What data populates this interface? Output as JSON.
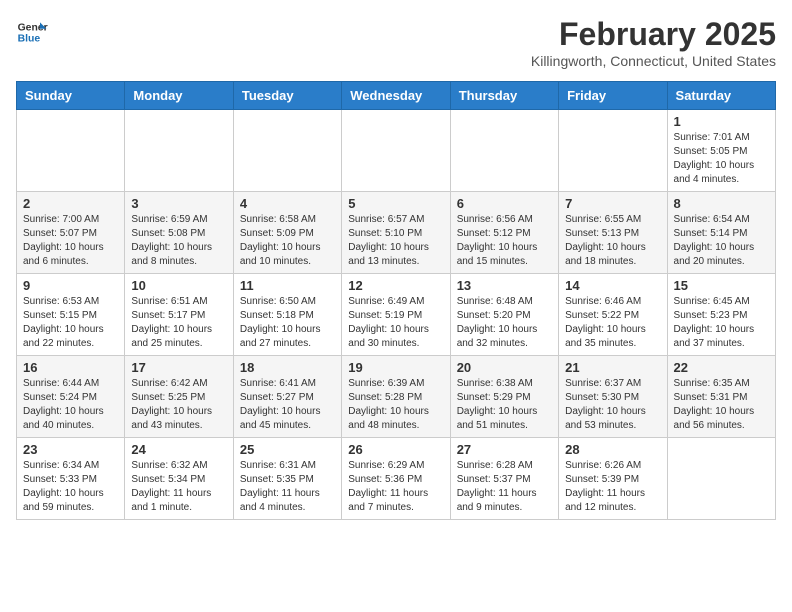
{
  "header": {
    "logo_general": "General",
    "logo_blue": "Blue",
    "month_title": "February 2025",
    "location": "Killingworth, Connecticut, United States"
  },
  "weekdays": [
    "Sunday",
    "Monday",
    "Tuesday",
    "Wednesday",
    "Thursday",
    "Friday",
    "Saturday"
  ],
  "weeks": [
    [
      {
        "day": "",
        "info": ""
      },
      {
        "day": "",
        "info": ""
      },
      {
        "day": "",
        "info": ""
      },
      {
        "day": "",
        "info": ""
      },
      {
        "day": "",
        "info": ""
      },
      {
        "day": "",
        "info": ""
      },
      {
        "day": "1",
        "info": "Sunrise: 7:01 AM\nSunset: 5:05 PM\nDaylight: 10 hours and 4 minutes."
      }
    ],
    [
      {
        "day": "2",
        "info": "Sunrise: 7:00 AM\nSunset: 5:07 PM\nDaylight: 10 hours and 6 minutes."
      },
      {
        "day": "3",
        "info": "Sunrise: 6:59 AM\nSunset: 5:08 PM\nDaylight: 10 hours and 8 minutes."
      },
      {
        "day": "4",
        "info": "Sunrise: 6:58 AM\nSunset: 5:09 PM\nDaylight: 10 hours and 10 minutes."
      },
      {
        "day": "5",
        "info": "Sunrise: 6:57 AM\nSunset: 5:10 PM\nDaylight: 10 hours and 13 minutes."
      },
      {
        "day": "6",
        "info": "Sunrise: 6:56 AM\nSunset: 5:12 PM\nDaylight: 10 hours and 15 minutes."
      },
      {
        "day": "7",
        "info": "Sunrise: 6:55 AM\nSunset: 5:13 PM\nDaylight: 10 hours and 18 minutes."
      },
      {
        "day": "8",
        "info": "Sunrise: 6:54 AM\nSunset: 5:14 PM\nDaylight: 10 hours and 20 minutes."
      }
    ],
    [
      {
        "day": "9",
        "info": "Sunrise: 6:53 AM\nSunset: 5:15 PM\nDaylight: 10 hours and 22 minutes."
      },
      {
        "day": "10",
        "info": "Sunrise: 6:51 AM\nSunset: 5:17 PM\nDaylight: 10 hours and 25 minutes."
      },
      {
        "day": "11",
        "info": "Sunrise: 6:50 AM\nSunset: 5:18 PM\nDaylight: 10 hours and 27 minutes."
      },
      {
        "day": "12",
        "info": "Sunrise: 6:49 AM\nSunset: 5:19 PM\nDaylight: 10 hours and 30 minutes."
      },
      {
        "day": "13",
        "info": "Sunrise: 6:48 AM\nSunset: 5:20 PM\nDaylight: 10 hours and 32 minutes."
      },
      {
        "day": "14",
        "info": "Sunrise: 6:46 AM\nSunset: 5:22 PM\nDaylight: 10 hours and 35 minutes."
      },
      {
        "day": "15",
        "info": "Sunrise: 6:45 AM\nSunset: 5:23 PM\nDaylight: 10 hours and 37 minutes."
      }
    ],
    [
      {
        "day": "16",
        "info": "Sunrise: 6:44 AM\nSunset: 5:24 PM\nDaylight: 10 hours and 40 minutes."
      },
      {
        "day": "17",
        "info": "Sunrise: 6:42 AM\nSunset: 5:25 PM\nDaylight: 10 hours and 43 minutes."
      },
      {
        "day": "18",
        "info": "Sunrise: 6:41 AM\nSunset: 5:27 PM\nDaylight: 10 hours and 45 minutes."
      },
      {
        "day": "19",
        "info": "Sunrise: 6:39 AM\nSunset: 5:28 PM\nDaylight: 10 hours and 48 minutes."
      },
      {
        "day": "20",
        "info": "Sunrise: 6:38 AM\nSunset: 5:29 PM\nDaylight: 10 hours and 51 minutes."
      },
      {
        "day": "21",
        "info": "Sunrise: 6:37 AM\nSunset: 5:30 PM\nDaylight: 10 hours and 53 minutes."
      },
      {
        "day": "22",
        "info": "Sunrise: 6:35 AM\nSunset: 5:31 PM\nDaylight: 10 hours and 56 minutes."
      }
    ],
    [
      {
        "day": "23",
        "info": "Sunrise: 6:34 AM\nSunset: 5:33 PM\nDaylight: 10 hours and 59 minutes."
      },
      {
        "day": "24",
        "info": "Sunrise: 6:32 AM\nSunset: 5:34 PM\nDaylight: 11 hours and 1 minute."
      },
      {
        "day": "25",
        "info": "Sunrise: 6:31 AM\nSunset: 5:35 PM\nDaylight: 11 hours and 4 minutes."
      },
      {
        "day": "26",
        "info": "Sunrise: 6:29 AM\nSunset: 5:36 PM\nDaylight: 11 hours and 7 minutes."
      },
      {
        "day": "27",
        "info": "Sunrise: 6:28 AM\nSunset: 5:37 PM\nDaylight: 11 hours and 9 minutes."
      },
      {
        "day": "28",
        "info": "Sunrise: 6:26 AM\nSunset: 5:39 PM\nDaylight: 11 hours and 12 minutes."
      },
      {
        "day": "",
        "info": ""
      }
    ]
  ]
}
